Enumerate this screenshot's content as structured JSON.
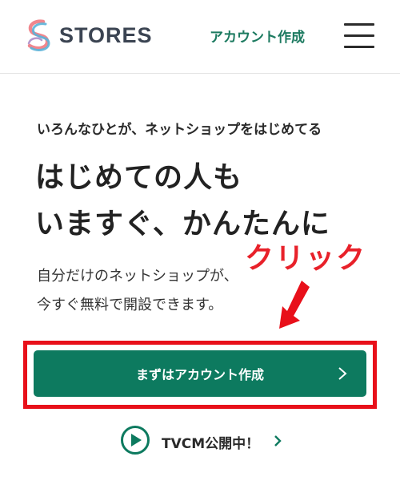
{
  "header": {
    "brand": "STORES",
    "account_link": "アカウント作成"
  },
  "hero": {
    "lead": "いろんなひとが、ネットショップをはじめてる",
    "headline_line1": "はじめての人も",
    "headline_line2": "いますぐ、かんたんに",
    "desc_line1": "自分だけのネットショップが、",
    "desc_line2": "今すぐ無料で開設できます。"
  },
  "cta": {
    "label": "まずはアカウント作成"
  },
  "tvcm": {
    "label": "TVCM公開中！"
  },
  "annotation": {
    "text": "クリック"
  },
  "colors": {
    "brand_green": "#0d7a5f",
    "annotation_red": "#e8101a"
  }
}
